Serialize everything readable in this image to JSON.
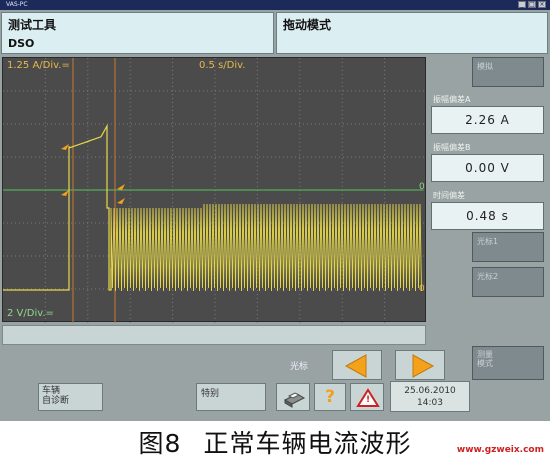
{
  "window": {
    "title": "VAS-PC",
    "controls": [
      "_",
      "□",
      "×"
    ]
  },
  "header": {
    "left_title": "测试工具",
    "left_subtitle": "DSO",
    "right_title": "拖动模式"
  },
  "scope": {
    "ch_a_scale": "1.25 A/Div.=",
    "time_scale": "0.5 s/Div.",
    "ch_b_scale": "2 V/Div.=",
    "zero_marker_a": "0",
    "zero_marker_b": "0",
    "colors": {
      "trace_a": "#e6d84a",
      "trace_b": "#58c058",
      "cursor": "#c87a32",
      "grid": "#7a7a7a"
    }
  },
  "side": {
    "top_button": "模拟",
    "measurements": [
      {
        "label": "振幅偏差A",
        "value": "2.26  A"
      },
      {
        "label": "振幅偏差B",
        "value": "0.00  V"
      },
      {
        "label": "时间偏差",
        "value": "0.48  s"
      }
    ],
    "cursor1": "光标1",
    "cursor2": "光标2",
    "bottom_button": "测量\n模式"
  },
  "bottom": {
    "cursor_label": "光标",
    "vehicle_diag": "车辆\n自诊断",
    "special": "特别",
    "help": "?",
    "warning": "!",
    "date": "25.06.2010",
    "time": "14:03"
  },
  "caption": {
    "figure_no": "图8",
    "text": "正常车辆电流波形"
  },
  "watermark": "www.gzweix.com"
}
